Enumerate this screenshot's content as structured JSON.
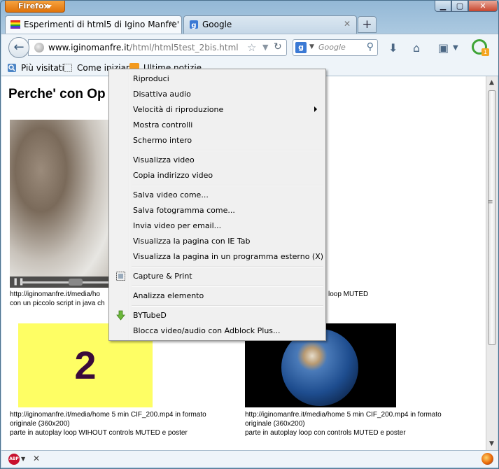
{
  "browser": {
    "menu_button": "Firefox",
    "tabs": [
      {
        "label": "Esperimenti di html5 di Igino Manfre'",
        "active": true
      },
      {
        "label": "Google",
        "active": false
      }
    ],
    "new_tab_label": "+",
    "address": {
      "host": "www.iginomanfre.it",
      "path": "/html/html5test_2bis.html"
    },
    "search_placeholder": "Google",
    "bookmarks": [
      "Più visitati",
      "Come iniziare",
      "Ultime notizie"
    ]
  },
  "page": {
    "title": "Perche' con Op",
    "caption1_line1": "http://iginomanfre.it/media/ho",
    "caption1_line2": "con un piccolo script in java ch",
    "caption2_line1": "loop MUTED",
    "yellow_number": "2",
    "caption3_line1": "http://iginomanfre.it/media/home 5 min CIF_200.mp4 in formato",
    "caption3_line2": "originale (360x200)",
    "caption3_line3": "parte in autoplay loop WIHOUT controls MUTED e poster",
    "caption4_line1": "http://iginomanfre.it/media/home 5 min CIF_200.mp4 in formato",
    "caption4_line2": "originale (360x200)",
    "caption4_line3": "parte in autoplay loop con controls MUTED e poster"
  },
  "context_menu": {
    "items": [
      "Riproduci",
      "Disattiva audio",
      "Velocità di riproduzione",
      "Mostra controlli",
      "Schermo intero",
      "Visualizza video",
      "Copia indirizzo video",
      "Salva video come...",
      "Salva fotogramma come...",
      "Invia video per email...",
      "Visualizza la pagina con IE Tab",
      "Visualizza la pagina in un programma esterno (X)",
      "Capture & Print",
      "Analizza elemento",
      "BYTubeD",
      "Blocca video/audio con Adblock Plus..."
    ]
  },
  "status": {
    "abp_label": "ABP"
  },
  "colors": {
    "accent_orange": "#e0730a",
    "yellow_box": "#fefe64",
    "adblock_red": "#c8102e",
    "tab_bg": "#f6f9fc"
  }
}
